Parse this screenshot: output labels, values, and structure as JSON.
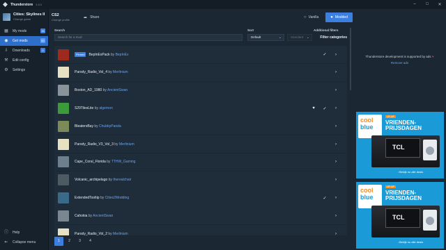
{
  "titlebar": {
    "app": "Thunderstore",
    "version": "1.0.1"
  },
  "game": {
    "name": "Cities: Skylines II",
    "sub": "Change game"
  },
  "nav": [
    {
      "label": "My mods",
      "badge": "16",
      "icon": "grid-icon"
    },
    {
      "label": "Get mods",
      "badge": "50",
      "icon": "globe-icon"
    },
    {
      "label": "Downloads",
      "badge": "0",
      "icon": "download-icon"
    },
    {
      "label": "Edit config",
      "badge": "",
      "icon": "wrench-icon"
    },
    {
      "label": "Settings",
      "badge": "",
      "icon": "gear-icon"
    }
  ],
  "bottom_nav": [
    {
      "label": "Help",
      "icon": "help-icon"
    },
    {
      "label": "Collapse menu",
      "icon": "collapse-icon"
    }
  ],
  "profile": {
    "name": "CS2",
    "sub": "Change profile"
  },
  "share_label": "Share",
  "vanilla_label": "Vanilla",
  "modded_label": "Modded",
  "filters": {
    "search_label": "Search",
    "search_placeholder": "Search for a mod",
    "sort_label": "Sort",
    "sort_value": "Default",
    "direction_value": "Standard",
    "additional_label": "Additional filters",
    "filter_categories": "Filter categories"
  },
  "mods": [
    {
      "name": "BepInExPack",
      "author": "BepInEx",
      "pinned": "Pinned",
      "installed": true,
      "liked": false,
      "thumb": "#a0291e"
    },
    {
      "name": "Parody_Radio_Vol_4",
      "author": "Merlinium",
      "pinned": "",
      "installed": false,
      "liked": false,
      "thumb": "#e7e1c4"
    },
    {
      "name": "Boston_AD_1980",
      "author": "AncientSwan",
      "pinned": "",
      "installed": false,
      "liked": false,
      "thumb": "#8a929a"
    },
    {
      "name": "S29TilesLite",
      "author": "algernon",
      "pinned": "",
      "installed": true,
      "liked": true,
      "thumb": "#3d9a3a"
    },
    {
      "name": "BleatersBay",
      "author": "ChubbyPanda",
      "pinned": "",
      "installed": false,
      "liked": false,
      "thumb": "#7c8a5a"
    },
    {
      "name": "Parody_Radio_V3_Vol_3",
      "author": "Merlinium",
      "pinned": "",
      "installed": false,
      "liked": false,
      "thumb": "#e7e1c4"
    },
    {
      "name": "Cape_Coral_Florida",
      "author": "TTHW_Gaming",
      "pinned": "",
      "installed": false,
      "liked": false,
      "thumb": "#6b7f8d"
    },
    {
      "name": "Volcanic_archipelago",
      "author": "therealchair",
      "pinned": "",
      "installed": false,
      "liked": false,
      "thumb": "#4e5a62"
    },
    {
      "name": "ExtendedTooltip",
      "author": "Cities2Modding",
      "pinned": "",
      "installed": true,
      "liked": false,
      "thumb": "#3a6a8a"
    },
    {
      "name": "Cahokia",
      "author": "AncientSwan",
      "pinned": "",
      "installed": false,
      "liked": false,
      "thumb": "#7a8690"
    },
    {
      "name": "Parody_Radio_Vol_2",
      "author": "Merlinium",
      "pinned": "",
      "installed": false,
      "liked": false,
      "thumb": "#e7e1c4"
    }
  ],
  "by_word": "by",
  "pages": [
    "1",
    "2",
    "3",
    "4"
  ],
  "ad_panel": {
    "support_text": "Thunderstore development is supported by ads",
    "remove_ads": "Remove ads",
    "ad": {
      "brand_top": "cool",
      "brand_bottom": "blue",
      "label": "UP-UP",
      "headline": "VRIENDEN-PRIJSDAGEN",
      "product": "TCL",
      "cta": "Bekijk nu alle deals"
    }
  },
  "colors": {
    "accent": "#3b7fe0",
    "background": "#1b2733",
    "sidebar": "#16212c",
    "row": "#1f2c39"
  }
}
